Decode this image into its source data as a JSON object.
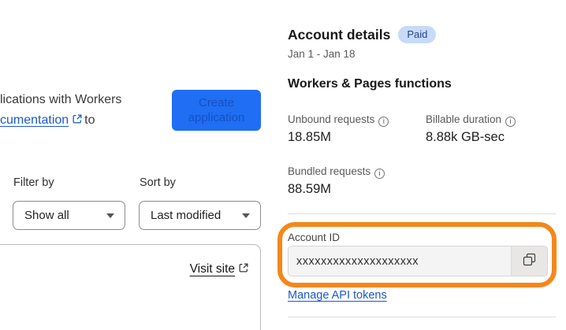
{
  "colors": {
    "accent_blue": "#1f6ef3",
    "link_blue": "#1b59c9",
    "badge_bg": "#c7dbf9",
    "badge_text": "#23418c",
    "highlight_orange": "#f5871a"
  },
  "left_page": {
    "intro_line1": "lications with Workers",
    "intro_link_text": "cumentation",
    "intro_after_link": "to",
    "create_button_label": "Create application",
    "filter_by_label": "Filter by",
    "filter_selected": "Show all",
    "sort_by_label": "Sort by",
    "sort_selected": "Last modified",
    "visit_site_label": "Visit site"
  },
  "account_panel": {
    "title": "Account details",
    "plan_badge": "Paid",
    "date_range": "Jan 1 - Jan 18",
    "section_title": "Workers & Pages functions",
    "stats": [
      {
        "label": "Unbound requests",
        "value": "18.85M"
      },
      {
        "label": "Billable duration",
        "value": "8.88k GB-sec"
      },
      {
        "label": "Bundled requests",
        "value": "88.59M"
      }
    ],
    "account_id": {
      "label": "Account ID",
      "value": "xxxxxxxxxxxxxxxxxxxx"
    },
    "manage_api_tokens_label": "Manage API tokens"
  }
}
